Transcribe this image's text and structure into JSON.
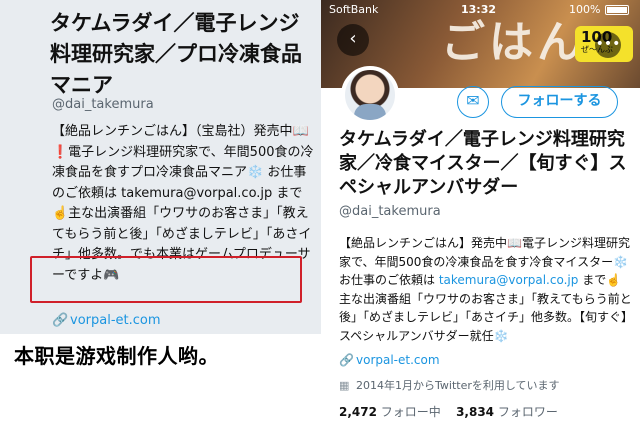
{
  "left": {
    "name": "タケムラダイ／電子レンジ料理研究家／プロ冷凍食品マニア",
    "handle": "@dai_takemura",
    "bio": "【絶品レンチンごはん】（宝島社）発売中📖❗電子レンジ料理研究家で、年間500食の冷凍食品を食すプロ冷凍食品マニア❄️ お仕事のご依頼は takemura@vorpal.co.jp まで☝️主な出演番組「ウワサのお客さま」「教えてもらう前と後」「めざましテレビ」「あさイチ」他多数。でも本業はゲームプロデューサーですよ🎮",
    "link": "vorpal-et.com",
    "link_icon": "link-icon",
    "highlight_color": "#d0202a"
  },
  "caption": "本职是游戏制作人哟。",
  "right": {
    "status": {
      "carrier": "SoftBank",
      "time": "13:32",
      "battery": "100%"
    },
    "banner_text": "ごはん",
    "badge": {
      "main": "100",
      "sub": "ぜ〜んぶ"
    },
    "back_icon": "back-arrow-icon",
    "more_icon": "more-dots-icon",
    "mail_icon": "mail-icon",
    "follow_label": "フォローする",
    "name": "タケムラダイ／電子レンジ料理研究家／冷食マイスター／【旬すぐ】スペシャルアンバサダー",
    "handle": "@dai_takemura",
    "bio_part1": "【絶品レンチンごはん】発売中📖電子レンジ料理研究家で、年間500食の冷凍食品を食す冷食マイスター❄️ お仕事のご依頼は ",
    "bio_email": "takemura@vorpal.co.jp",
    "bio_part2": " まで☝️主な出演番組「ウワサのお客さま」「教えてもらう前と後」「めざましテレビ」「あさイチ」他多数。【旬すぐ】スペシャルアンバサダー就任❄️",
    "link": "vorpal-et.com",
    "joined": "2014年1月からTwitterを利用しています",
    "following_count": "2,472",
    "following_label": "フォロー中",
    "followers_count": "3,834",
    "followers_label": "フォロワー",
    "accent_color": "#1b95e0"
  }
}
